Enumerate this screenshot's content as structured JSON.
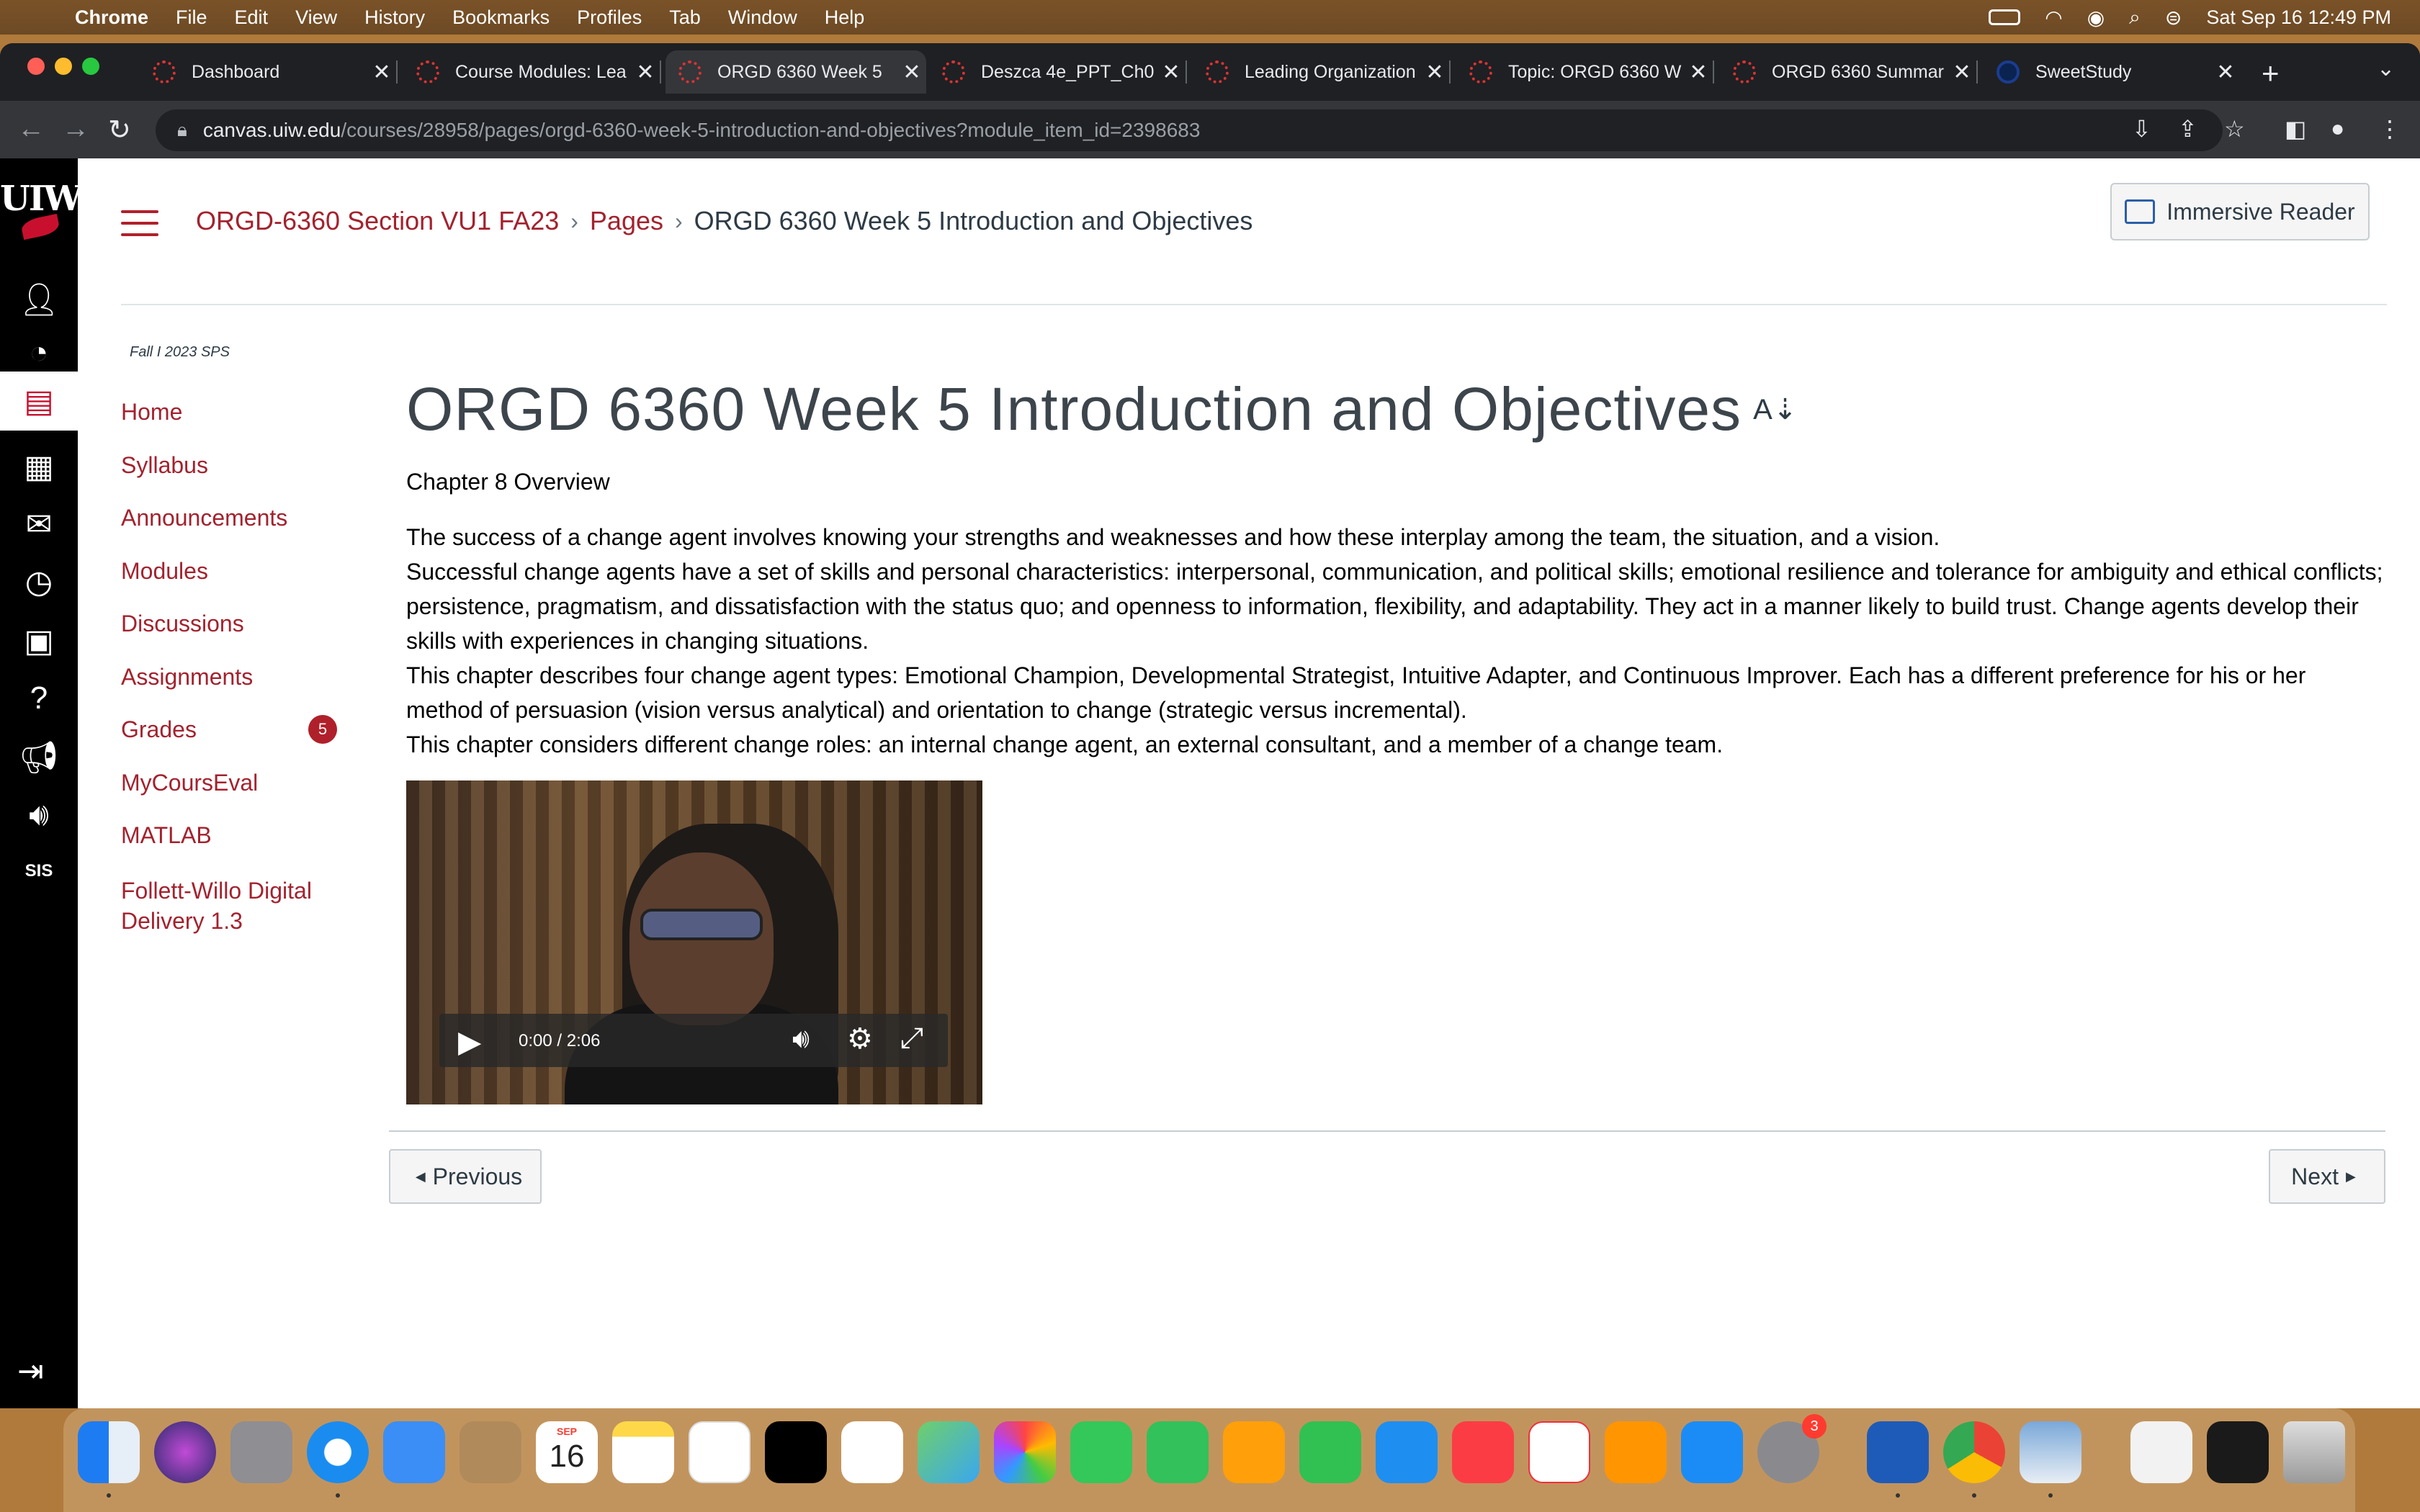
{
  "menubar": {
    "items": [
      "Chrome",
      "File",
      "Edit",
      "View",
      "History",
      "Bookmarks",
      "Profiles",
      "Tab",
      "Window",
      "Help"
    ],
    "clock": "Sat Sep 16  12:49 PM"
  },
  "tabs": [
    {
      "title": "Dashboard"
    },
    {
      "title": "Course Modules: Lea"
    },
    {
      "title": "ORGD 6360 Week 5"
    },
    {
      "title": "Deszca 4e_PPT_Ch0"
    },
    {
      "title": "Leading Organization"
    },
    {
      "title": "Topic: ORGD 6360 W"
    },
    {
      "title": "ORGD 6360 Summar"
    },
    {
      "title": "SweetStudy"
    }
  ],
  "omnibox": {
    "host": "canvas.uiw.edu",
    "path": "/courses/28958/pages/orgd-6360-week-5-introduction-and-objectives?module_item_id=2398683"
  },
  "global_nav": {
    "logo": "UIW"
  },
  "breadcrumb": {
    "course": "ORGD-6360 Section VU1 FA23",
    "section": "Pages",
    "current": "ORGD 6360 Week 5 Introduction and Objectives"
  },
  "immersive_reader": "Immersive Reader",
  "course_nav": {
    "term": "Fall I 2023 SPS",
    "items": [
      "Home",
      "Syllabus",
      "Announcements",
      "Modules",
      "Discussions",
      "Assignments",
      "Grades",
      "MyCoursEval",
      "MATLAB",
      "Follett-Willo Digital Delivery 1.3"
    ],
    "grades_badge": "5"
  },
  "content": {
    "title": "ORGD 6360 Week 5 Introduction and Objectives",
    "subheading": "Chapter 8 Overview",
    "paragraphs": [
      "The success of a change agent involves knowing your strengths and weaknesses and how these interplay among the team, the situation, and a vision.",
      "Successful change agents have a set of skills and personal characteristics: interpersonal, communication, and political skills; emotional resilience and tolerance for ambiguity and ethical conflicts; persistence, pragmatism, and dissatisfaction with the status quo; and openness to information, flexibility, and adaptability. They act in a manner likely to build trust. Change agents develop their skills with experiences in changing situations.",
      "This chapter describes four change agent types: Emotional Champion, Developmental Strategist, Intuitive Adapter, and Continuous Improver. Each has a different preference for his or her method of persuasion (vision versus analytical) and orientation to change (strategic versus incremental).",
      "This chapter considers different change roles: an internal change agent, an external consultant, and a member of a change team."
    ],
    "video": {
      "time": "0:00 / 2:06"
    }
  },
  "pager": {
    "previous": "Previous",
    "next": "Next"
  },
  "dock": {
    "calendar_month": "SEP",
    "calendar_day": "16",
    "settings_badge": "3"
  }
}
